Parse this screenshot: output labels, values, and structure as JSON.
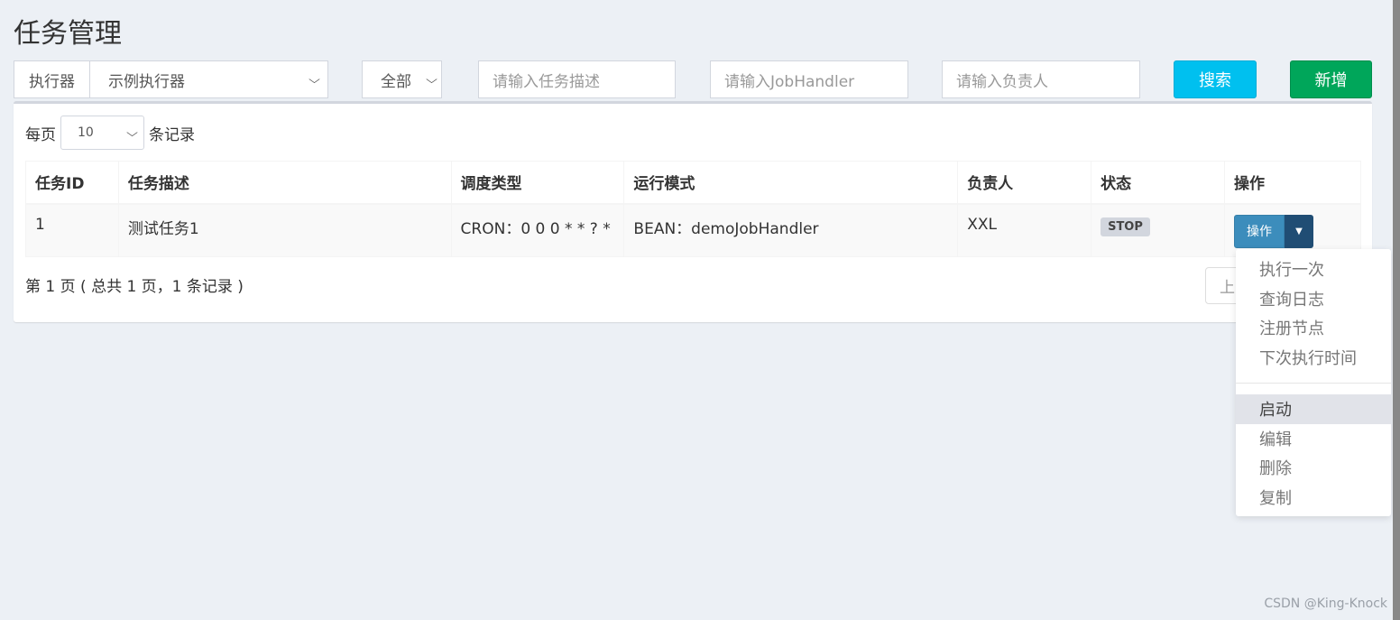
{
  "page": {
    "title": "任务管理"
  },
  "filters": {
    "executor_label": "执行器",
    "executor_value": "示例执行器",
    "status_value": "全部",
    "desc_placeholder": "请输入任务描述",
    "handler_placeholder": "请输入JobHandler",
    "author_placeholder": "请输入负责人",
    "search_label": "搜索",
    "add_label": "新增"
  },
  "perpage": {
    "prefix": "每页",
    "value": "10",
    "suffix": "条记录"
  },
  "table": {
    "headers": [
      "任务ID",
      "任务描述",
      "调度类型",
      "运行模式",
      "负责人",
      "状态",
      "操作"
    ],
    "rows": [
      {
        "id": "1",
        "desc": "测试任务1",
        "schedule": "CRON：0 0 0 * * ? *",
        "mode": "BEAN：demoJobHandler",
        "author": "XXL",
        "status": "STOP",
        "op_label": "操作"
      }
    ]
  },
  "pagination": {
    "info": "第 1 页 ( 总共 1 页，1 条记录 )",
    "prev_label": "上"
  },
  "dropdown": {
    "items_top": [
      "执行一次",
      "查询日志",
      "注册节点",
      "下次执行时间"
    ],
    "items_bottom": [
      "启动",
      "编辑",
      "删除",
      "复制"
    ]
  },
  "watermark": "CSDN @King-Knock",
  "colors": {
    "primary": "#3c8dbc",
    "search": "#00c0ef",
    "add": "#00a65a",
    "background": "#ecf0f5"
  }
}
